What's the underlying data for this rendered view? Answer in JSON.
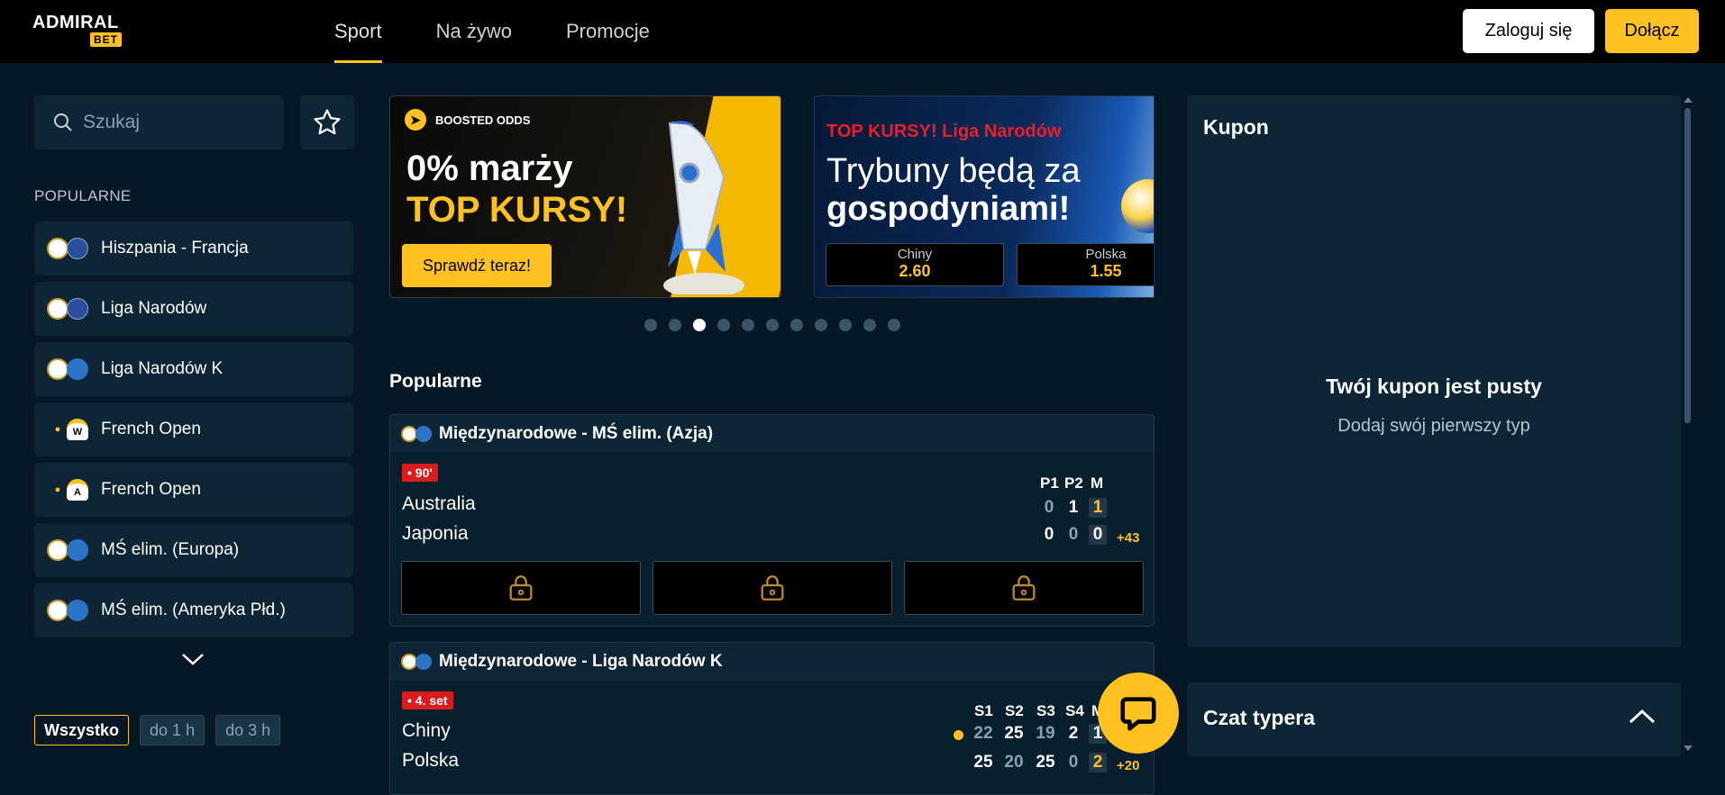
{
  "brand": {
    "word": "ADMIRAL",
    "badge": "BET"
  },
  "nav": [
    {
      "label": "Sport",
      "active": true
    },
    {
      "label": "Na żywo",
      "active": false
    },
    {
      "label": "Promocje",
      "active": false
    }
  ],
  "auth": {
    "login_label": "Zaloguj się",
    "join_label": "Dołącz"
  },
  "search": {
    "placeholder": "Szukaj"
  },
  "sidebar": {
    "section_title": "POPULARNE",
    "items": [
      {
        "label": "Hiszpania - Francja",
        "sport": "football",
        "region": "eu"
      },
      {
        "label": "Liga Narodów",
        "sport": "football",
        "region": "eu"
      },
      {
        "label": "Liga Narodów K",
        "sport": "volleyball",
        "region": "world"
      },
      {
        "label": "French Open",
        "sport": "tennis",
        "tag": "W"
      },
      {
        "label": "French Open",
        "sport": "tennis",
        "tag": "A"
      },
      {
        "label": "MŚ elim. (Europa)",
        "sport": "football",
        "region": "world"
      },
      {
        "label": "MŚ elim. (Ameryka Płd.)",
        "sport": "football",
        "region": "world"
      }
    ],
    "filters": [
      {
        "label": "Wszystko",
        "active": true
      },
      {
        "label": "do 1 h",
        "active": false
      },
      {
        "label": "do 3 h",
        "active": false
      }
    ]
  },
  "banners": {
    "b1": {
      "tag": "BOOSTED ODDS",
      "line1": "0% marży",
      "line2": "TOP KURSY!",
      "button": "Sprawdź teraz!"
    },
    "b2": {
      "tag": "TOP KURSY! Liga Narodów",
      "line1": "Trybuny będą za",
      "line2": "gospodyniami!",
      "odds": [
        {
          "name": "Chiny",
          "value": "2.60"
        },
        {
          "name": "Polska",
          "value": "1.55"
        }
      ]
    },
    "dots_count": 11,
    "active_dot": 3
  },
  "popular": {
    "title": "Popularne",
    "events": [
      {
        "league": "Międzynarodowe - MŚ elim. (Azja)",
        "status": "• 90'",
        "score_headers": [
          "P1",
          "P2",
          "M"
        ],
        "teams": [
          {
            "name": "Australia",
            "scores": [
              "0",
              "1",
              "1"
            ]
          },
          {
            "name": "Japonia",
            "scores": [
              "0",
              "0",
              "0"
            ]
          }
        ],
        "more": "+43"
      },
      {
        "league": "Międzynarodowe - Liga Narodów K",
        "status": "• 4. set",
        "score_headers": [
          "S1",
          "S2",
          "S3",
          "S4",
          "M"
        ],
        "teams": [
          {
            "name": "Chiny",
            "scores": [
              "22",
              "25",
              "19",
              "2",
              "1"
            ]
          },
          {
            "name": "Polska",
            "scores": [
              "25",
              "20",
              "25",
              "0",
              "2"
            ]
          }
        ],
        "more": "+20"
      }
    ]
  },
  "coupon": {
    "title": "Kupon",
    "empty_title": "Twój kupon jest pusty",
    "empty_sub": "Dodaj swój pierwszy typ"
  },
  "chat": {
    "title": "Czat typera"
  },
  "colors": {
    "accent": "#ffc220",
    "bg": "#061826",
    "panel": "#0d2535",
    "live": "#d91c1c"
  }
}
